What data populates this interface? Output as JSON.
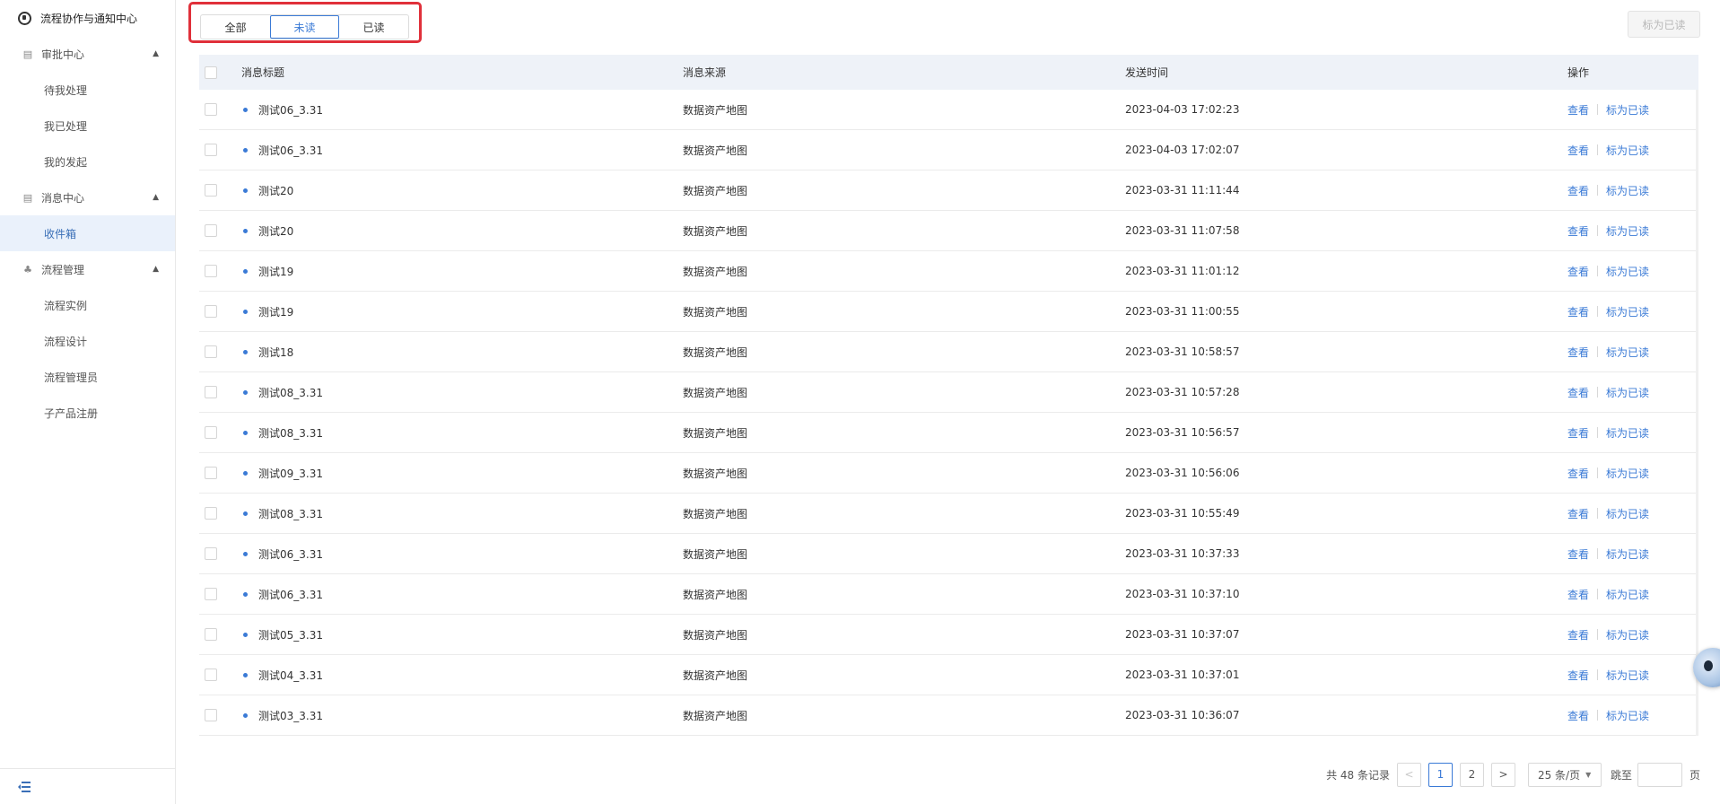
{
  "sidebar": {
    "brand": "流程协作与通知中心",
    "groups": [
      {
        "label": "审批中心",
        "items": [
          "待我处理",
          "我已处理",
          "我的发起"
        ]
      },
      {
        "label": "消息中心",
        "items": [
          "收件箱"
        ]
      },
      {
        "label": "流程管理",
        "items": [
          "流程实例",
          "流程设计",
          "流程管理员",
          "子产品注册"
        ]
      }
    ]
  },
  "tabs": {
    "all": "全部",
    "unread": "未读",
    "read": "已读",
    "selected": "未读"
  },
  "toolbar": {
    "mark_all_read": "标为已读"
  },
  "table": {
    "headers": {
      "title": "消息标题",
      "source": "消息来源",
      "time": "发送时间",
      "ops": "操作"
    },
    "rows": [
      {
        "title": "测试06_3.31",
        "source": "数据资产地图",
        "time": "2023-04-03 17:02:23"
      },
      {
        "title": "测试06_3.31",
        "source": "数据资产地图",
        "time": "2023-04-03 17:02:07"
      },
      {
        "title": "测试20",
        "source": "数据资产地图",
        "time": "2023-03-31 11:11:44"
      },
      {
        "title": "测试20",
        "source": "数据资产地图",
        "time": "2023-03-31 11:07:58"
      },
      {
        "title": "测试19",
        "source": "数据资产地图",
        "time": "2023-03-31 11:01:12"
      },
      {
        "title": "测试19",
        "source": "数据资产地图",
        "time": "2023-03-31 11:00:55"
      },
      {
        "title": "测试18",
        "source": "数据资产地图",
        "time": "2023-03-31 10:58:57"
      },
      {
        "title": "测试08_3.31",
        "source": "数据资产地图",
        "time": "2023-03-31 10:57:28"
      },
      {
        "title": "测试08_3.31",
        "source": "数据资产地图",
        "time": "2023-03-31 10:56:57"
      },
      {
        "title": "测试09_3.31",
        "source": "数据资产地图",
        "time": "2023-03-31 10:56:06"
      },
      {
        "title": "测试08_3.31",
        "source": "数据资产地图",
        "time": "2023-03-31 10:55:49"
      },
      {
        "title": "测试06_3.31",
        "source": "数据资产地图",
        "time": "2023-03-31 10:37:33"
      },
      {
        "title": "测试06_3.31",
        "source": "数据资产地图",
        "time": "2023-03-31 10:37:10"
      },
      {
        "title": "测试05_3.31",
        "source": "数据资产地图",
        "time": "2023-03-31 10:37:07"
      },
      {
        "title": "测试04_3.31",
        "source": "数据资产地图",
        "time": "2023-03-31 10:37:01"
      },
      {
        "title": "测试03_3.31",
        "source": "数据资产地图",
        "time": "2023-03-31 10:36:07"
      }
    ],
    "row_actions": {
      "view": "查看",
      "mark_read": "标为已读"
    }
  },
  "pagination": {
    "total_text": "共 48 条记录",
    "pages": [
      "1",
      "2"
    ],
    "current_page": "1",
    "prev": "<",
    "next": ">",
    "page_size": "25 条/页",
    "jump_label": "跳至",
    "page_unit": "页"
  },
  "colors": {
    "accent": "#3a7ad6",
    "highlight_border": "#e0303a",
    "header_bg": "#eef2f8"
  }
}
